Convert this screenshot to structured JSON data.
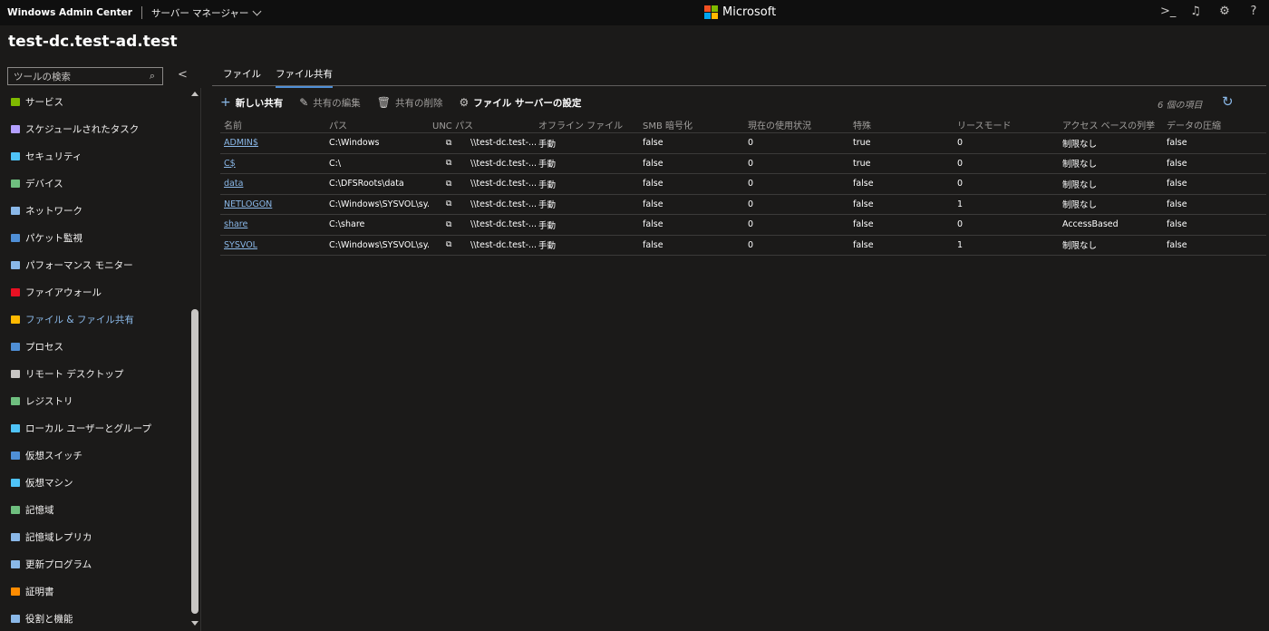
{
  "topbar": {
    "brand": "Windows Admin Center",
    "tool": "サーバー マネージャー",
    "ms_label": "Microsoft",
    "icons": [
      "terminal-icon",
      "bell-icon",
      "gear-icon",
      "help-icon"
    ],
    "icon_glyphs": {
      "terminal": ">_",
      "bell": "♫",
      "gear": "⚙",
      "help": "?"
    }
  },
  "server": {
    "name": "test-dc.test-ad.test"
  },
  "search": {
    "placeholder": "ツールの検索",
    "icon": "⌕"
  },
  "sidebar": {
    "items": [
      {
        "label": "サービス",
        "icon": "services-icon",
        "color": "#7fba00"
      },
      {
        "label": "スケジュールされたタスク",
        "icon": "scheduled-tasks-icon",
        "color": "#b4a0ff"
      },
      {
        "label": "セキュリティ",
        "icon": "shield-icon",
        "color": "#4fc3f7"
      },
      {
        "label": "デバイス",
        "icon": "devices-icon",
        "color": "#6fbf7f"
      },
      {
        "label": "ネットワーク",
        "icon": "network-icon",
        "color": "#8ab8e8"
      },
      {
        "label": "パケット監視",
        "icon": "packet-icon",
        "color": "#4f8fd6"
      },
      {
        "label": "パフォーマンス モニター",
        "icon": "performance-icon",
        "color": "#8ab8e8"
      },
      {
        "label": "ファイアウォール",
        "icon": "firewall-icon",
        "color": "#e81123"
      },
      {
        "label": "ファイル & ファイル共有",
        "icon": "folder-icon",
        "color": "#ffb900",
        "active": true
      },
      {
        "label": "プロセス",
        "icon": "process-icon",
        "color": "#4f8fd6"
      },
      {
        "label": "リモート デスクトップ",
        "icon": "remote-desktop-icon",
        "color": "#c8c6c4"
      },
      {
        "label": "レジストリ",
        "icon": "registry-icon",
        "color": "#6fbf7f"
      },
      {
        "label": "ローカル ユーザーとグループ",
        "icon": "users-icon",
        "color": "#4fc3f7"
      },
      {
        "label": "仮想スイッチ",
        "icon": "virtual-switch-icon",
        "color": "#4f8fd6"
      },
      {
        "label": "仮想マシン",
        "icon": "virtual-machine-icon",
        "color": "#4fc3f7"
      },
      {
        "label": "記憶域",
        "icon": "storage-icon",
        "color": "#6fbf7f"
      },
      {
        "label": "記憶域レプリカ",
        "icon": "storage-replica-icon",
        "color": "#8ab8e8"
      },
      {
        "label": "更新プログラム",
        "icon": "updates-icon",
        "color": "#8ab8e8"
      },
      {
        "label": "証明書",
        "icon": "certificate-icon",
        "color": "#ff8c00"
      },
      {
        "label": "役割と機能",
        "icon": "roles-icon",
        "color": "#8ab8e8"
      }
    ]
  },
  "tabs": {
    "files": "ファイル",
    "shares": "ファイル共有"
  },
  "toolbar": {
    "new_share": "新しい共有",
    "edit_share": "共有の編集",
    "delete_share": "共有の削除",
    "server_settings": "ファイル サーバーの設定",
    "item_count": "6 個の項目",
    "glyphs": {
      "plus": "+",
      "pencil": "✎",
      "trash": "🗑",
      "gear": "⚙",
      "refresh": "↻"
    }
  },
  "grid": {
    "headers": [
      "名前",
      "パス",
      "UNC パス",
      "オフライン ファイル",
      "SMB 暗号化",
      "現在の使用状況",
      "特殊",
      "リースモード",
      "アクセス ベースの列挙",
      "データの圧縮"
    ],
    "copy_glyph": "⧉",
    "rows": [
      {
        "name": "ADMIN$",
        "path": "C:\\Windows",
        "unc": "\\\\test-dc.test-...",
        "offline": "手動",
        "smb": "false",
        "usage": "0",
        "special": "true",
        "lease": "0",
        "abe": "制限なし",
        "compress": "false"
      },
      {
        "name": "C$",
        "path": "C:\\",
        "unc": "\\\\test-dc.test-...",
        "offline": "手動",
        "smb": "false",
        "usage": "0",
        "special": "true",
        "lease": "0",
        "abe": "制限なし",
        "compress": "false"
      },
      {
        "name": "data",
        "path": "C:\\DFSRoots\\data",
        "unc": "\\\\test-dc.test-...",
        "offline": "手動",
        "smb": "false",
        "usage": "0",
        "special": "false",
        "lease": "0",
        "abe": "制限なし",
        "compress": "false"
      },
      {
        "name": "NETLOGON",
        "path": "C:\\Windows\\SYSVOL\\sy...",
        "unc": "\\\\test-dc.test-...",
        "offline": "手動",
        "smb": "false",
        "usage": "0",
        "special": "false",
        "lease": "1",
        "abe": "制限なし",
        "compress": "false"
      },
      {
        "name": "share",
        "path": "C:\\share",
        "unc": "\\\\test-dc.test-...",
        "offline": "手動",
        "smb": "false",
        "usage": "0",
        "special": "false",
        "lease": "0",
        "abe": "AccessBased",
        "compress": "false"
      },
      {
        "name": "SYSVOL",
        "path": "C:\\Windows\\SYSVOL\\sy...",
        "unc": "\\\\test-dc.test-...",
        "offline": "手動",
        "smb": "false",
        "usage": "0",
        "special": "false",
        "lease": "1",
        "abe": "制限なし",
        "compress": "false"
      }
    ]
  }
}
